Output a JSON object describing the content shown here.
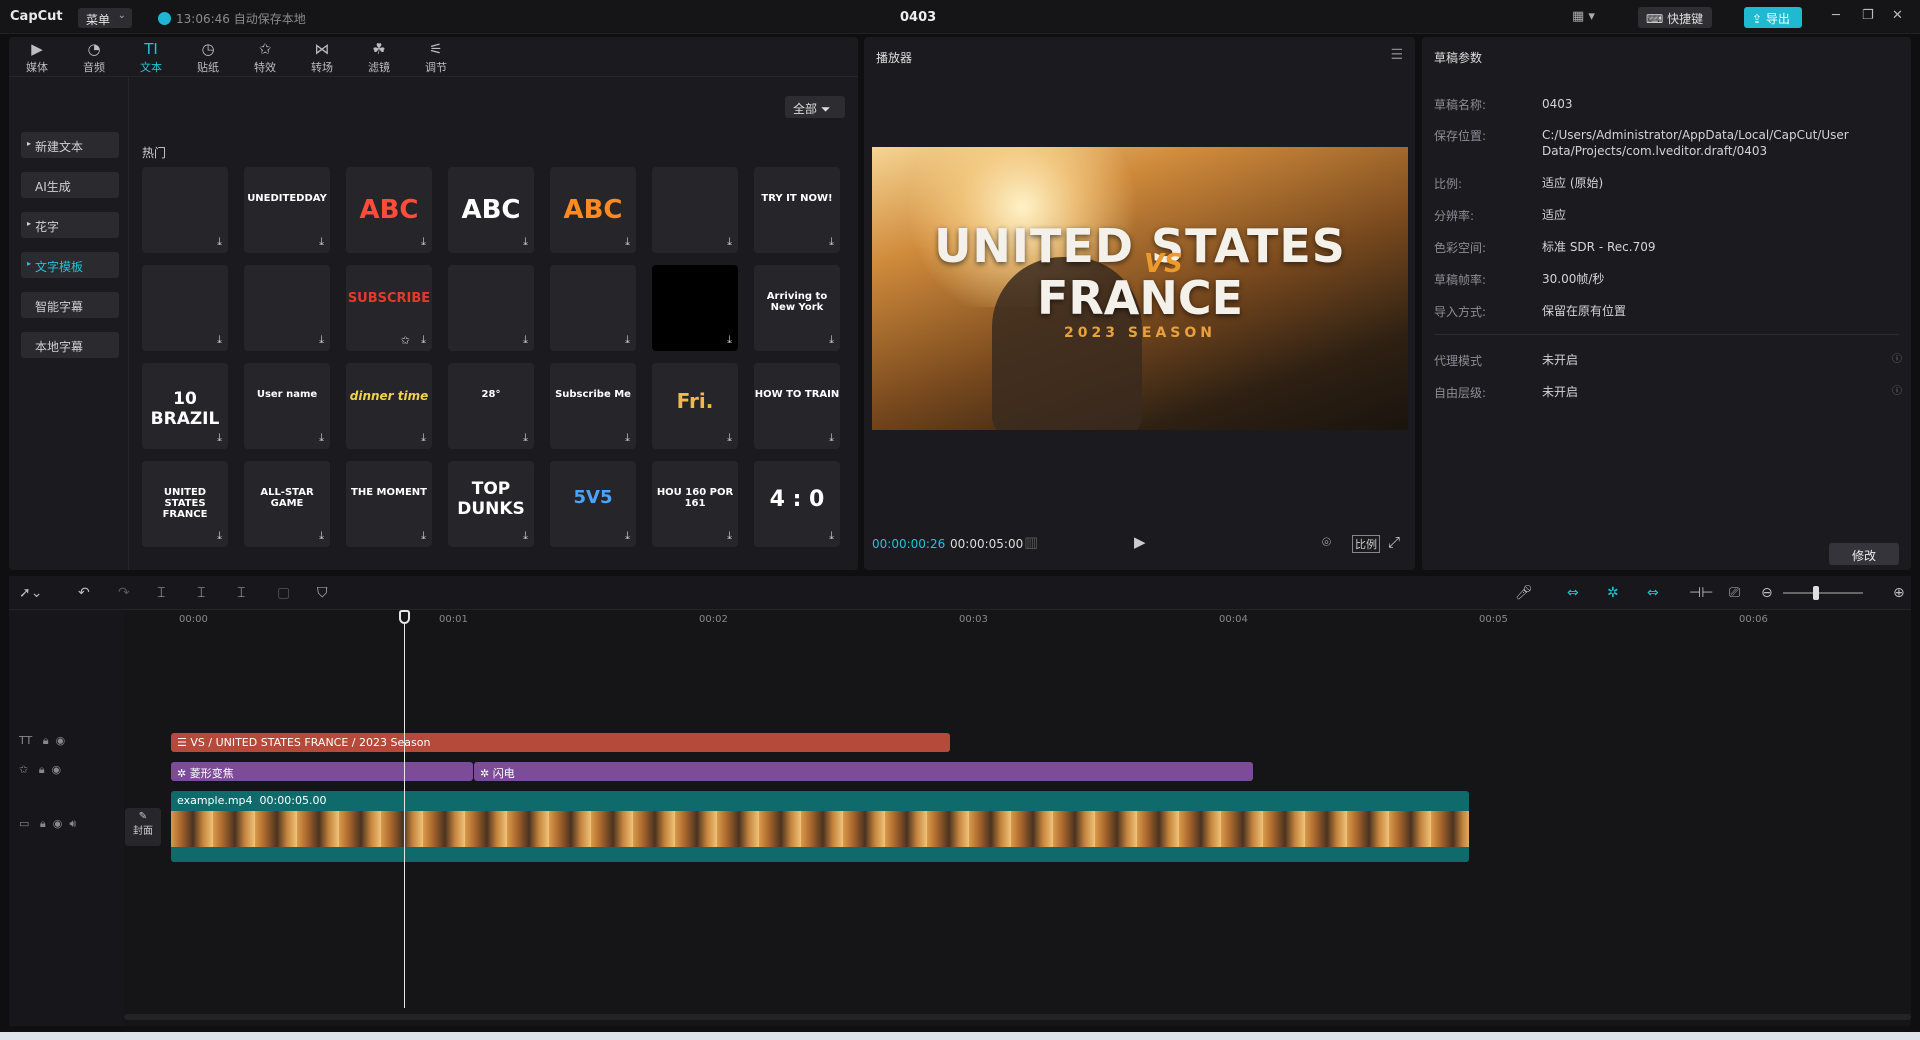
{
  "titlebar": {
    "logo": "CapCut",
    "menu_label": "菜单",
    "autosave": "13:06:46 自动保存本地",
    "project_title": "0403",
    "hotkeys_label": "快捷键",
    "export_label": "导出"
  },
  "tools": [
    {
      "label": "媒体",
      "icon": "media-icon"
    },
    {
      "label": "音频",
      "icon": "audio-icon"
    },
    {
      "label": "文本",
      "icon": "text-icon",
      "active": true
    },
    {
      "label": "贴纸",
      "icon": "sticker-icon"
    },
    {
      "label": "特效",
      "icon": "effects-icon"
    },
    {
      "label": "转场",
      "icon": "transition-icon"
    },
    {
      "label": "滤镜",
      "icon": "filter-icon"
    },
    {
      "label": "调节",
      "icon": "adjust-icon"
    }
  ],
  "categories": [
    {
      "label": "新建文本",
      "arrow": true
    },
    {
      "label": "AI生成",
      "arrow": false
    },
    {
      "label": "花字",
      "arrow": true
    },
    {
      "label": "文字模板",
      "arrow": true,
      "active": true
    },
    {
      "label": "智能字幕",
      "arrow": false
    },
    {
      "label": "本地字幕",
      "arrow": false
    }
  ],
  "filter_label": "全部",
  "section_title": "热门",
  "templates": [
    [
      "",
      "UNEDITEDDAY",
      "ABC",
      "ABC",
      "ABC",
      "",
      "TRY IT NOW!"
    ],
    [
      "",
      "",
      "SUBSCRIBE",
      "",
      "",
      "",
      "Arriving to New York"
    ],
    [
      "10 BRAZIL",
      "User name",
      "dinner time",
      "28°",
      "Subscribe Me",
      "Fri.",
      "HOW TO TRAIN"
    ],
    [
      "UNITED STATES FRANCE",
      "ALL-STAR GAME",
      "THE MOMENT",
      "TOP DUNKS",
      "5V5",
      "HOU 160 POR 161",
      "4 : 0"
    ]
  ],
  "player": {
    "title": "播放器",
    "video_line1": "UNITED STATES",
    "video_vs": "VS",
    "video_line2": "FRANCE",
    "video_season": "2023 SEASON",
    "current_time": "00:00:00:26",
    "total_time": "00:00:05:00",
    "ratio_label": "比例"
  },
  "props": {
    "title": "草稿参数",
    "rows": [
      {
        "k": "草稿名称:",
        "v": "0403"
      },
      {
        "k": "保存位置:",
        "v": "C:/Users/Administrator/AppData/Local/CapCut/User Data/Projects/com.lveditor.draft/0403"
      },
      {
        "k": "比例:",
        "v": "适应 (原始)"
      },
      {
        "k": "分辨率:",
        "v": "适应"
      },
      {
        "k": "色彩空间:",
        "v": "标准 SDR - Rec.709"
      },
      {
        "k": "草稿帧率:",
        "v": "30.00帧/秒"
      },
      {
        "k": "导入方式:",
        "v": "保留在原有位置"
      },
      {
        "k": "代理模式",
        "v": "未开启"
      },
      {
        "k": "自由层级:",
        "v": "未开启"
      }
    ],
    "modify_label": "修改"
  },
  "timeline": {
    "ticks": [
      "00:00",
      "00:01",
      "00:02",
      "00:03",
      "00:04",
      "00:05",
      "00:06"
    ],
    "text_clip": "VS / UNITED STATES FRANCE / 2023 Season",
    "effect_clip1": "菱形变焦",
    "effect_clip2": "闪电",
    "video_clip_name": "example.mp4",
    "video_clip_duration": "00:00:05.00",
    "cover_label": "封面"
  },
  "colors": {
    "accent": "#21c3dc",
    "text_clip": "#b5493a",
    "effect_clip": "#7c4c98",
    "video_clip": "#0f6b6b"
  }
}
